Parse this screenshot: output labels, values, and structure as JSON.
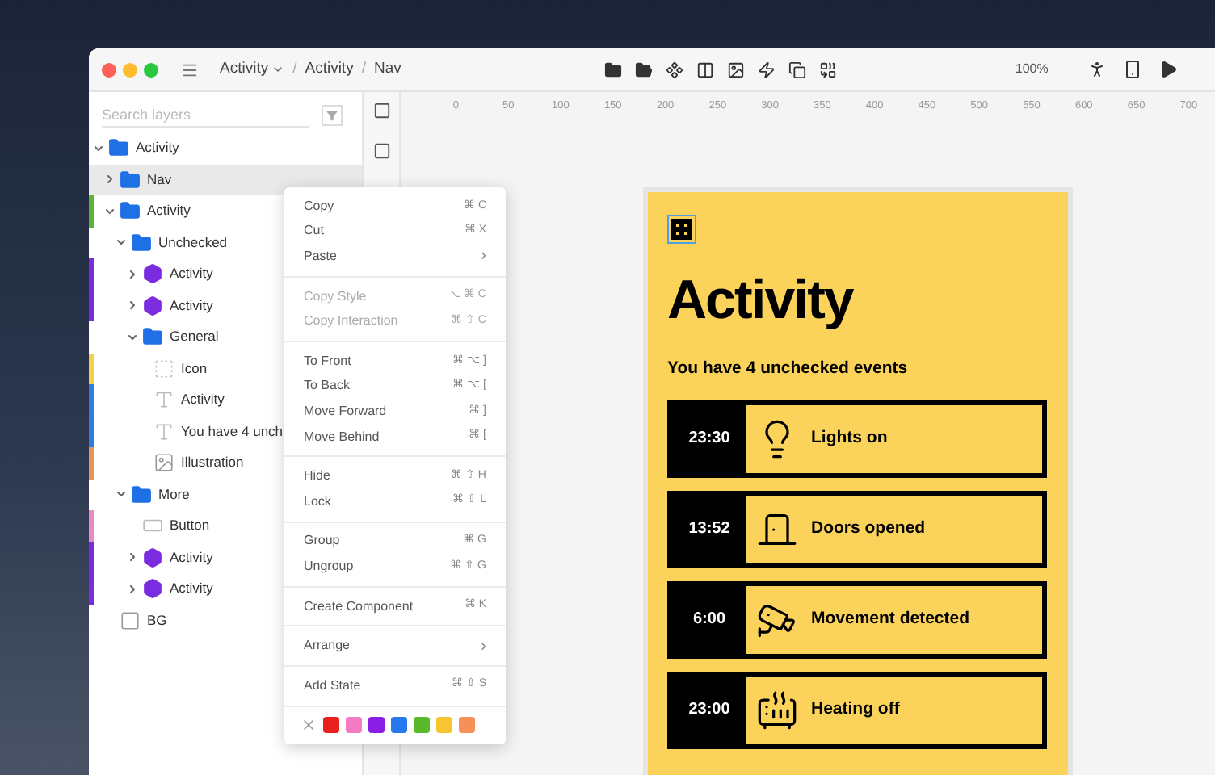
{
  "window": {
    "breadcrumbs": [
      {
        "label": "Activity",
        "dropdown": true
      },
      {
        "separator": "/",
        "label": "Activity",
        "dropdown": false
      },
      {
        "separator": "/",
        "label": "Nav",
        "dropdown": false
      }
    ],
    "zoom": "100%"
  },
  "sidebar": {
    "search": {
      "placeholder": "Search layers"
    },
    "layers": [
      {
        "label": "Activity",
        "kind": "folder",
        "expanded": true,
        "selected": false,
        "children": [
          {
            "label": "Nav",
            "kind": "folder",
            "expanded": false,
            "selected": true
          },
          {
            "label": "Activity",
            "kind": "folder",
            "expanded": true,
            "selected": false,
            "color": "#5cb53a",
            "children": [
              {
                "label": "Unchecked",
                "kind": "folder",
                "expanded": true,
                "selected": false,
                "children": [
                  {
                    "label": "Activity",
                    "kind": "component",
                    "expanded": false,
                    "selected": false,
                    "color": "#7b2be0"
                  },
                  {
                    "label": "Activity",
                    "kind": "component",
                    "expanded": false,
                    "selected": false,
                    "color": "#7b2be0"
                  },
                  {
                    "label": "General",
                    "kind": "folder",
                    "expanded": true,
                    "selected": false,
                    "children": [
                      {
                        "label": "Icon",
                        "kind": "pattern",
                        "selected": false,
                        "color": "#f2d24a"
                      },
                      {
                        "label": "Activity",
                        "kind": "text",
                        "selected": false,
                        "color": "#2f7de1"
                      },
                      {
                        "label": "You have 4 unch",
                        "kind": "text",
                        "selected": false,
                        "color": "#2f7de1"
                      },
                      {
                        "label": "Illustration",
                        "kind": "image",
                        "selected": false,
                        "color": "#e8955a"
                      }
                    ]
                  }
                ]
              },
              {
                "label": "More",
                "kind": "folder",
                "expanded": true,
                "selected": false,
                "children": [
                  {
                    "label": "Button",
                    "kind": "button",
                    "selected": false,
                    "color": "#e88ac4"
                  },
                  {
                    "label": "Activity",
                    "kind": "component",
                    "expanded": false,
                    "selected": false,
                    "color": "#7b2be0"
                  },
                  {
                    "label": "Activity",
                    "kind": "component",
                    "expanded": false,
                    "selected": false,
                    "color": "#7b2be0"
                  }
                ]
              }
            ]
          },
          {
            "label": "BG",
            "kind": "rect",
            "selected": false
          }
        ]
      }
    ]
  },
  "canvas": {
    "ruler_ticks": [
      "0",
      "50",
      "100",
      "150",
      "200",
      "250",
      "300",
      "350",
      "400",
      "450",
      "500",
      "550",
      "600",
      "650",
      "700"
    ]
  },
  "context_menu": {
    "items": [
      {
        "kind": "item",
        "label": "Copy",
        "shortcut": "⌘ C",
        "disabled": false
      },
      {
        "kind": "item",
        "label": "Cut",
        "shortcut": "⌘ X",
        "disabled": false
      },
      {
        "kind": "submenu",
        "label": "Paste",
        "shortcut": "›",
        "disabled": false
      },
      {
        "kind": "separator"
      },
      {
        "kind": "item",
        "label": "Copy Style",
        "shortcut": "⌥ ⌘ C",
        "disabled": true
      },
      {
        "kind": "item",
        "label": "Copy Interaction",
        "shortcut": "⌘ ⇧ C",
        "disabled": true
      },
      {
        "kind": "separator"
      },
      {
        "kind": "item",
        "label": "To Front",
        "shortcut": "⌘ ⌥ ]",
        "disabled": false
      },
      {
        "kind": "item",
        "label": "To Back",
        "shortcut": "⌘ ⌥ [",
        "disabled": false
      },
      {
        "kind": "item",
        "label": "Move Forward",
        "shortcut": "⌘ ]",
        "disabled": false
      },
      {
        "kind": "item",
        "label": "Move Behind",
        "shortcut": "⌘ [",
        "disabled": false
      },
      {
        "kind": "separator"
      },
      {
        "kind": "item",
        "label": "Hide",
        "shortcut": "⌘ ⇧ H",
        "disabled": false
      },
      {
        "kind": "item",
        "label": "Lock",
        "shortcut": "⌘ ⇧ L",
        "disabled": false
      },
      {
        "kind": "separator"
      },
      {
        "kind": "item",
        "label": "Group",
        "shortcut": "⌘ G",
        "disabled": false
      },
      {
        "kind": "item",
        "label": "Ungroup",
        "shortcut": "⌘ ⇧ G",
        "disabled": false
      },
      {
        "kind": "separator"
      },
      {
        "kind": "item",
        "label": "Create Component",
        "shortcut": "⌘ K",
        "disabled": false
      },
      {
        "kind": "separator"
      },
      {
        "kind": "submenu",
        "label": "Arrange",
        "shortcut": "›",
        "disabled": false
      },
      {
        "kind": "separator"
      },
      {
        "kind": "item",
        "label": "Add State",
        "shortcut": "⌘ ⇧ S",
        "disabled": false
      }
    ],
    "swatches": [
      {
        "color": "#e8201e"
      },
      {
        "color": "#f27bc4"
      },
      {
        "color": "#8a1de6"
      },
      {
        "color": "#2878ee"
      },
      {
        "color": "#5ab92a"
      },
      {
        "color": "#f7c531"
      },
      {
        "color": "#f5905a"
      }
    ]
  },
  "artboard": {
    "title": "Activity",
    "subtitle": "You have 4 unchecked events",
    "events": [
      {
        "time": "23:30",
        "label": "Lights on",
        "kind": "light"
      },
      {
        "time": "13:52",
        "label": "Doors opened",
        "kind": "door"
      },
      {
        "time": "6:00",
        "label": "Movement detected",
        "kind": "camera"
      },
      {
        "time": "23:00",
        "label": "Heating off",
        "kind": "heater"
      }
    ]
  }
}
